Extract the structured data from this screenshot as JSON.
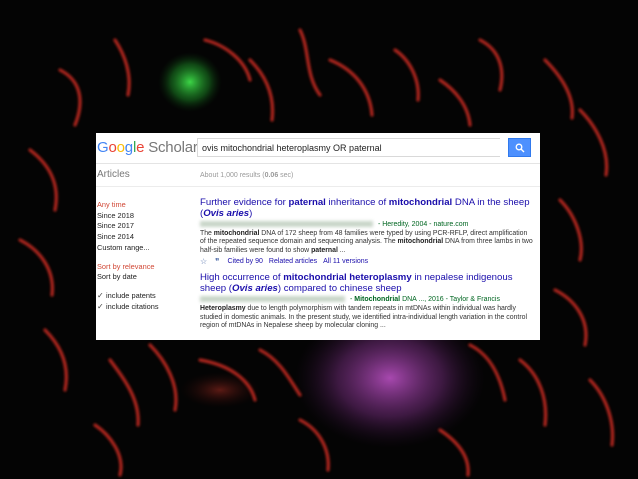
{
  "app": {
    "logo_google": [
      "G",
      "o",
      "o",
      "g",
      "l",
      "e"
    ],
    "logo_scholar": "Scholar"
  },
  "search": {
    "query": "ovis mitochondrial heteroplasmy OR paternal",
    "button_icon": "search-icon"
  },
  "header": {
    "articles_label": "Articles",
    "results_prefix": "About 1,000 results (",
    "results_time": "0.06",
    "results_suffix": " sec)"
  },
  "sidebar": {
    "time_filters": [
      "Any time",
      "Since 2018",
      "Since 2017",
      "Since 2014",
      "Custom range..."
    ],
    "sort_options": [
      "Sort by relevance",
      "Sort by date"
    ],
    "checkboxes": [
      "include patents",
      "include citations"
    ]
  },
  "results": [
    {
      "title_parts": [
        {
          "t": "Further evidence for ",
          "b": false
        },
        {
          "t": "paternal",
          "b": true
        },
        {
          "t": " inheritance of ",
          "b": false
        },
        {
          "t": "mitochondrial",
          "b": true
        },
        {
          "t": " DNA in the sheep (",
          "b": false
        },
        {
          "t": "Ovis aries",
          "b": true,
          "i": true
        },
        {
          "t": ")",
          "b": false
        }
      ],
      "source_parts": [
        {
          "t": " - Heredity, 2004 - nature.com",
          "b": false
        }
      ],
      "snippet_parts": [
        {
          "t": "The ",
          "b": false
        },
        {
          "t": "mitochondrial",
          "b": true
        },
        {
          "t": " DNA of 172 sheep from 48 families were typed by using PCR-RFLP, direct amplification of the repeated sequence domain and sequencing analysis. The ",
          "b": false
        },
        {
          "t": "mitochondrial",
          "b": true
        },
        {
          "t": " DNA from three lambs in two half-sib families were found to show ",
          "b": false
        },
        {
          "t": "paternal",
          "b": true
        },
        {
          "t": " ...",
          "b": false
        }
      ],
      "cited_by": "Cited by 90",
      "related": "Related articles",
      "versions": "All 11 versions"
    },
    {
      "title_parts": [
        {
          "t": "High occurrence of ",
          "b": false
        },
        {
          "t": "mitochondrial heteroplasmy",
          "b": true
        },
        {
          "t": " in nepalese indigenous sheep (",
          "b": false
        },
        {
          "t": "Ovis aries",
          "b": true,
          "i": true
        },
        {
          "t": ") compared to chinese sheep",
          "b": false
        }
      ],
      "source_parts": [
        {
          "t": " - ",
          "b": false
        },
        {
          "t": "Mitochondrial",
          "b": true
        },
        {
          "t": " DNA ..., 2016 - Taylor & Francis",
          "b": false
        }
      ],
      "snippet_parts": [
        {
          "t": "Heteroplasmy",
          "b": true
        },
        {
          "t": " due to length polymorphism with tandem repeats in mtDNAs within individual was hardly studied in domestic animals. In the present study, we identified intra-individual length variation in the control region of mtDNAs in Nepalese sheep by molecular cloning ...",
          "b": false
        }
      ]
    }
  ],
  "colors": {
    "link": "#1a0dab",
    "source": "#006621",
    "active_filter": "#d14836",
    "search_button": "#4d90fe"
  }
}
